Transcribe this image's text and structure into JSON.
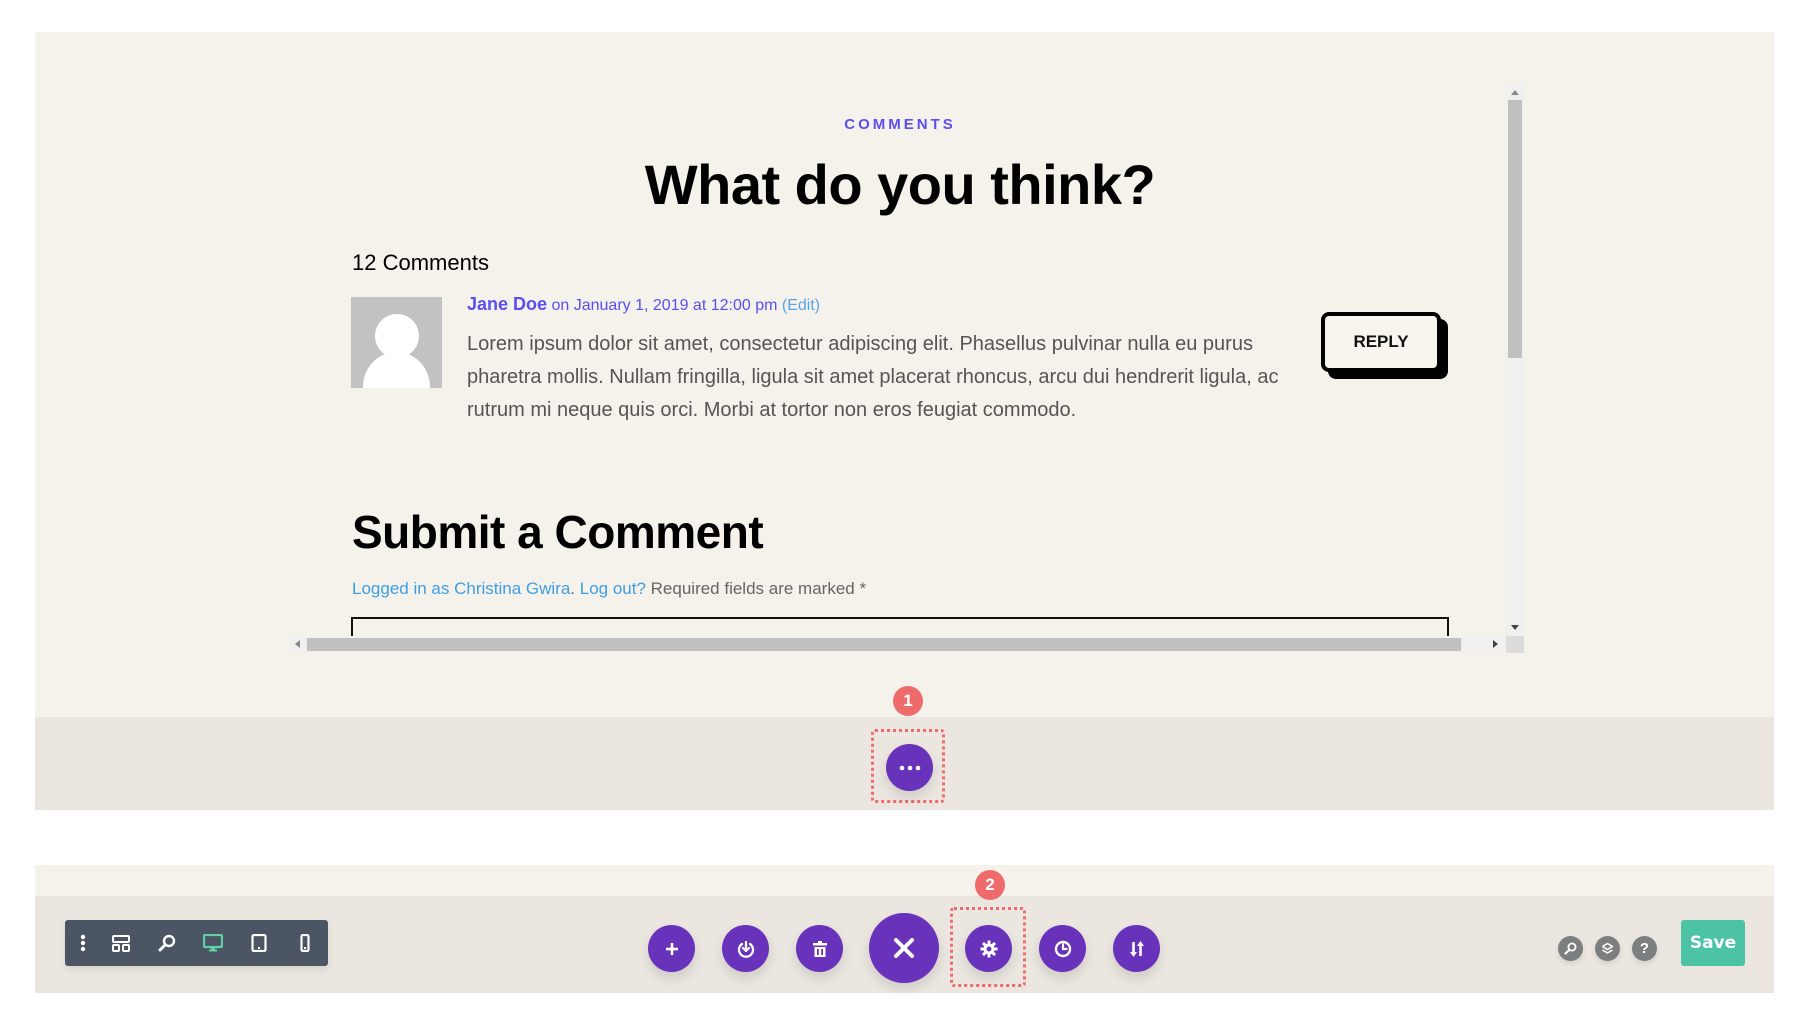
{
  "content": {
    "eyebrow": "COMMENTS",
    "heading": "What do you think?",
    "comment_count": "12 Comments",
    "comment": {
      "author": "Jane Doe",
      "date": " on January 1, 2019 at 12:00 pm ",
      "edit_link": "(Edit)",
      "text": "Lorem ipsum dolor sit amet, consectetur adipiscing elit. Phasellus pulvinar nulla eu purus pharetra mollis. Nullam fringilla, ligula sit amet placerat rhoncus, arcu dui hendrerit ligula, ac rutrum mi neque quis orci. Morbi at tortor non eros feugiat commodo.",
      "reply_label": "REPLY"
    },
    "submit_heading": "Submit a Comment",
    "logged_in": {
      "logged_in_link": "Logged in as Christina Gwira",
      "separator": ". ",
      "logout_link": "Log out?",
      "required_text": " Required fields are marked *"
    }
  },
  "annotations": {
    "badge_1": "1",
    "badge_2": "2"
  },
  "toolbar": {
    "left_items": [
      {
        "icon": "more-vertical-icon"
      },
      {
        "icon": "wireframe-icon"
      },
      {
        "icon": "zoom-icon"
      },
      {
        "icon": "desktop-icon",
        "active": true
      },
      {
        "icon": "tablet-icon"
      },
      {
        "icon": "phone-icon"
      }
    ],
    "center_buttons": [
      {
        "icon": "plus-icon",
        "name": "add"
      },
      {
        "icon": "portability-icon",
        "name": "portability"
      },
      {
        "icon": "trash-icon",
        "name": "delete"
      },
      {
        "icon": "close-icon",
        "name": "close"
      },
      {
        "icon": "gear-icon",
        "name": "settings"
      },
      {
        "icon": "history-icon",
        "name": "history"
      },
      {
        "icon": "sort-icon",
        "name": "sort"
      }
    ],
    "right_icons": [
      {
        "icon": "search-icon"
      },
      {
        "icon": "layers-icon"
      },
      {
        "icon": "help-icon",
        "glyph": "?"
      }
    ],
    "save_label": "Save"
  },
  "colors": {
    "accent_purple": "#6832bb",
    "link_blue": "#5b4ef0",
    "badge_red": "#ef6b6b",
    "save_green": "#4cc3a5",
    "active_device": "#5ed3a8"
  }
}
